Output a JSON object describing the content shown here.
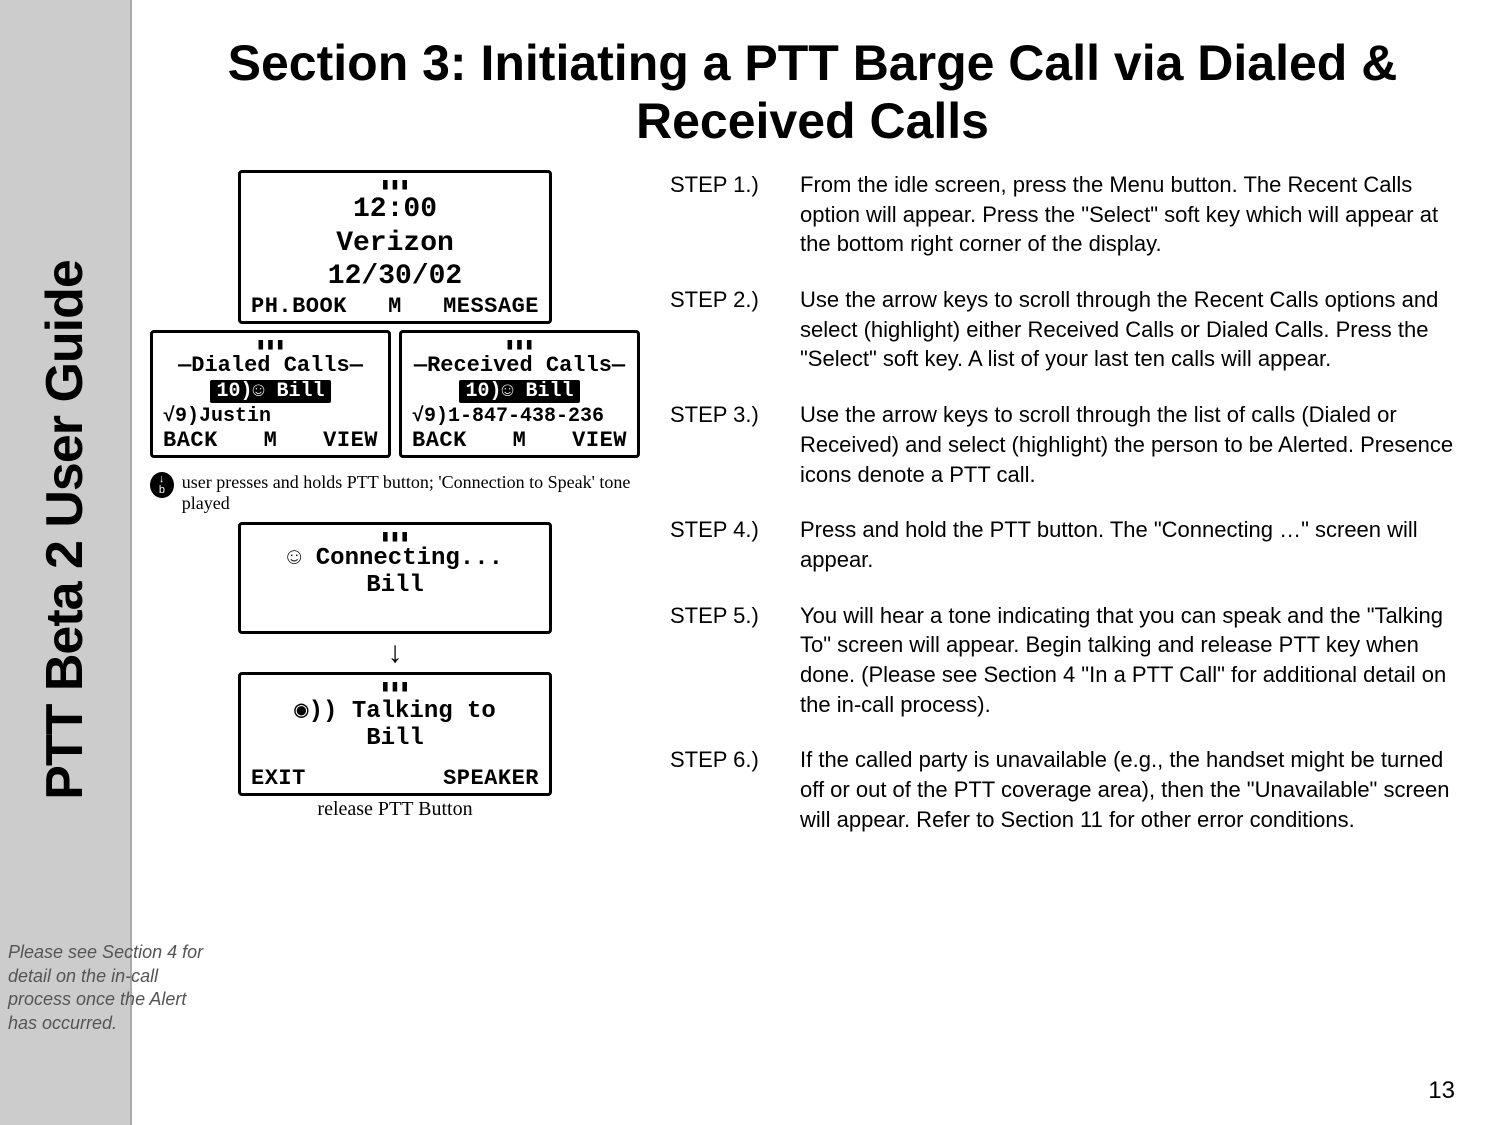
{
  "sidebar": {
    "title": "PTT Beta 2 User Guide",
    "note": "Please see Section 4 for detail on the in-call process once the Alert has occurred."
  },
  "page": {
    "title": "Section 3: Initiating a PTT Barge Call via Dialed & Received Calls",
    "number": "13"
  },
  "idle_screen": {
    "time": "12:00",
    "carrier": "Verizon",
    "date": "12/30/02",
    "soft_left": "PH.BOOK",
    "soft_mid": "M",
    "soft_right": "MESSAGE"
  },
  "dialed_calls": {
    "header": "—Dialed Calls—",
    "highlight": "10)☺ Bill",
    "row2": "√9)Justin",
    "soft_left": "BACK",
    "soft_mid": "M",
    "soft_right": "VIEW"
  },
  "received_calls": {
    "header": "—Received Calls—",
    "highlight": "10)☺ Bill",
    "row2": "√9)1-847-438-236",
    "soft_left": "BACK",
    "soft_mid": "M",
    "soft_right": "VIEW"
  },
  "press_note": "user presses and holds  PTT button; 'Connection to Speak' tone played",
  "connecting": {
    "line1": "☺ Connecting...",
    "line2": "Bill"
  },
  "talking": {
    "line1": "Talking to",
    "line2": "Bill",
    "soft_left": "EXIT",
    "soft_right": "SPEAKER"
  },
  "release_caption": "release PTT Button",
  "steps": [
    {
      "label": "STEP 1.)",
      "text": "From the idle screen, press the Menu button.  The Recent Calls option will appear.  Press the \"Select\" soft key which will appear at the bottom right corner of the display."
    },
    {
      "label": "STEP 2.)",
      "text": "Use the arrow keys to scroll through the Recent Calls options and select (highlight) either Received Calls or Dialed Calls. Press the \"Select\" soft key.  A list of your last ten calls will appear."
    },
    {
      "label": "STEP 3.)",
      "text": "Use the arrow keys to scroll through the list of calls (Dialed or Received) and select (highlight) the person to be Alerted. Presence icons denote a PTT call."
    },
    {
      "label": "STEP 4.)",
      "text": "Press and hold the PTT button.  The \"Connecting …\" screen will appear."
    },
    {
      "label": "STEP 5.)",
      "text": "You will hear a tone indicating that you can speak and the \"Talking To\" screen will appear.    Begin talking and release PTT key when done.  (Please see Section 4 \"In a PTT Call\" for additional detail on the in-call process)."
    },
    {
      "label": "STEP 6.)",
      "text": "If the called party is unavailable (e.g., the handset might be turned off or out of the PTT coverage area), then the \"Unavailable\" screen will appear. Refer to Section 11 for other error conditions."
    }
  ]
}
